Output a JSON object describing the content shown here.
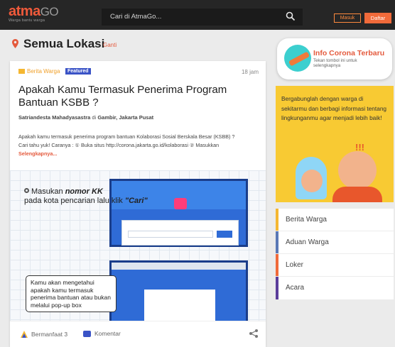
{
  "brand": {
    "name_main": "atma",
    "name_suffix": "GO",
    "tagline": "Warga bantu warga"
  },
  "search": {
    "placeholder": "Cari di AtmaGo..."
  },
  "auth": {
    "login_label": "Masuk",
    "register_label": "Daftar"
  },
  "location": {
    "title": "Semua Lokasi",
    "change_label": "Ganti"
  },
  "post": {
    "category": "Berita Warga",
    "badge": "Featured",
    "time": "18 jam",
    "title": "Apakah Kamu Termasuk Penerima Program Bantuan KSBB ?",
    "author": "Satriandesta Mahadyasastra",
    "author_sep": "di",
    "place": "Gambir, Jakarta Pusat",
    "excerpt_line1": "Apakah kamu termasuk penerima program bantuan Kolaborasi Sosial Berskala Besar (KSBB) ?",
    "excerpt_line2": "Cari tahu yuk! Caranya : ① Buka situs http://corona.jakarta.go.id/kolaborasi ② Masukkan",
    "read_more": "Selengkapnya...",
    "image": {
      "step1_prefix": "Masukan ",
      "step1_bold": "nomor KK",
      "step1_mid": " pada kota pencarian lalu klik ",
      "step1_quote": "\"Cari\"",
      "step2": "Kamu akan mengetahui apakah kamu termasuk penerima bantuan atau bukan melalui pop-up box"
    },
    "helpful_label": "Bermanfaat",
    "helpful_count": "3",
    "comment_label": "Komentar"
  },
  "sidebar": {
    "corona_title": "Info Corona Terbaru",
    "corona_sub": "Tekan tombol ini untuk selengkapnya",
    "promo_text": "Bergabunglah dengan warga di sekitarmu dan berbagi informasi tentang lingkunganmu agar menjadi lebih baik!",
    "promo_exclaim": "!!!",
    "menu": [
      {
        "label": "Berita Warga",
        "color": "#f5b731"
      },
      {
        "label": "Aduan Warga",
        "color": "#5a78b5"
      },
      {
        "label": "Loker",
        "color": "#f06a3a"
      },
      {
        "label": "Acara",
        "color": "#5b3d9a"
      }
    ]
  }
}
